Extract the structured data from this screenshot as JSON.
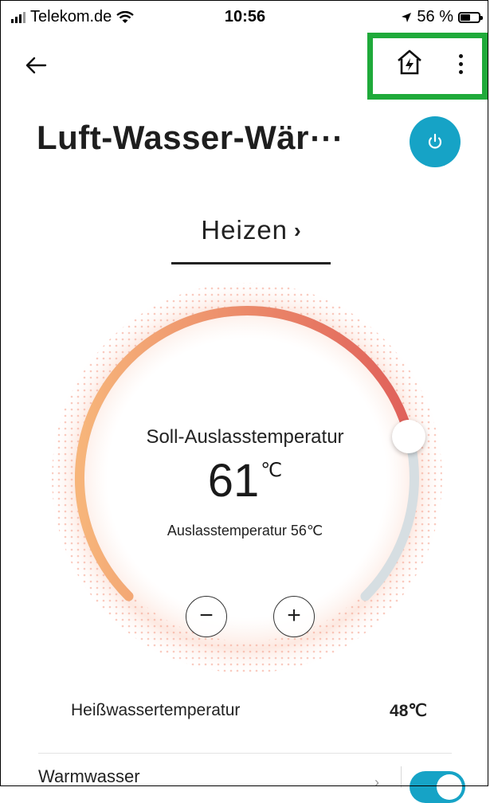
{
  "status_bar": {
    "carrier": "Telekom.de",
    "time": "10:56",
    "battery": "56 %",
    "battery_level": 0.56
  },
  "header": {
    "title": "Luft-Wasser-Wär⋯",
    "icons": [
      "back-arrow-icon",
      "home-energy-icon",
      "more-vertical-icon",
      "power-icon"
    ]
  },
  "mode": {
    "label": "Heizen",
    "chevron": "›"
  },
  "dial": {
    "set_label": "Soll-Auslasstemperatur",
    "set_value": "61",
    "unit": "℃",
    "outlet_text": "Auslasstemperatur 56℃",
    "minus": "−",
    "plus": "+",
    "level": 0.78,
    "colors": {
      "start": "#f7b57a",
      "end": "#e0605a",
      "track": "#d6dee2"
    }
  },
  "hot_water": {
    "label": "Heißwassertemperatur",
    "value": "48℃"
  },
  "warm_water": {
    "label": "Warmwasser",
    "enabled": true
  },
  "colors": {
    "accent": "#16a3c6",
    "highlight": "#1faa3a"
  }
}
